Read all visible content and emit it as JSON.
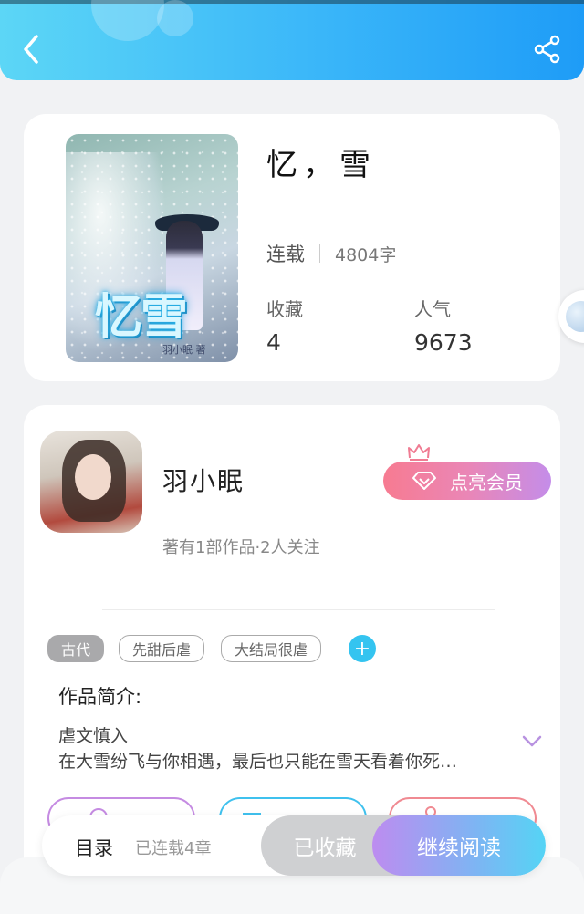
{
  "header": {
    "back_icon": "chevron-left-icon",
    "share_icon": "share-icon",
    "gradient": [
      "#5cd6f6",
      "#1e9cf7"
    ]
  },
  "book": {
    "cover_title_art": "忆雪",
    "cover_author_art": "羽小眠 著",
    "title": "忆，雪",
    "status": "连载",
    "word_count": "4804字",
    "favorites_label": "收藏",
    "favorites_value": "4",
    "popularity_label": "人气",
    "popularity_value": "9673"
  },
  "author": {
    "name": "羽小眠",
    "meta": "著有1部作品·2人关注",
    "vip_button": "点亮会员",
    "vip_colors": [
      "#f77b91",
      "#c48de9"
    ]
  },
  "tags": [
    {
      "label": "古代",
      "style": "filled"
    },
    {
      "label": "先甜后虐",
      "style": "outline"
    },
    {
      "label": "大结局很虐",
      "style": "outline"
    }
  ],
  "intro": {
    "label": "作品简介:",
    "line1": "虐文慎入",
    "line2": "在大雪纷飞与你相遇，最后也只能在雪天看着你死…"
  },
  "action_pills": [
    {
      "icon": "smile-icon",
      "color": "#c58be2"
    },
    {
      "icon": "gift-icon",
      "color": "#3fc1ee"
    },
    {
      "icon": "person-icon",
      "color": "#f08a92"
    }
  ],
  "bottom_bar": {
    "toc_label": "目录",
    "toc_status": "已连载4章",
    "favorited_button": "已收藏",
    "continue_button": "继续阅读"
  }
}
